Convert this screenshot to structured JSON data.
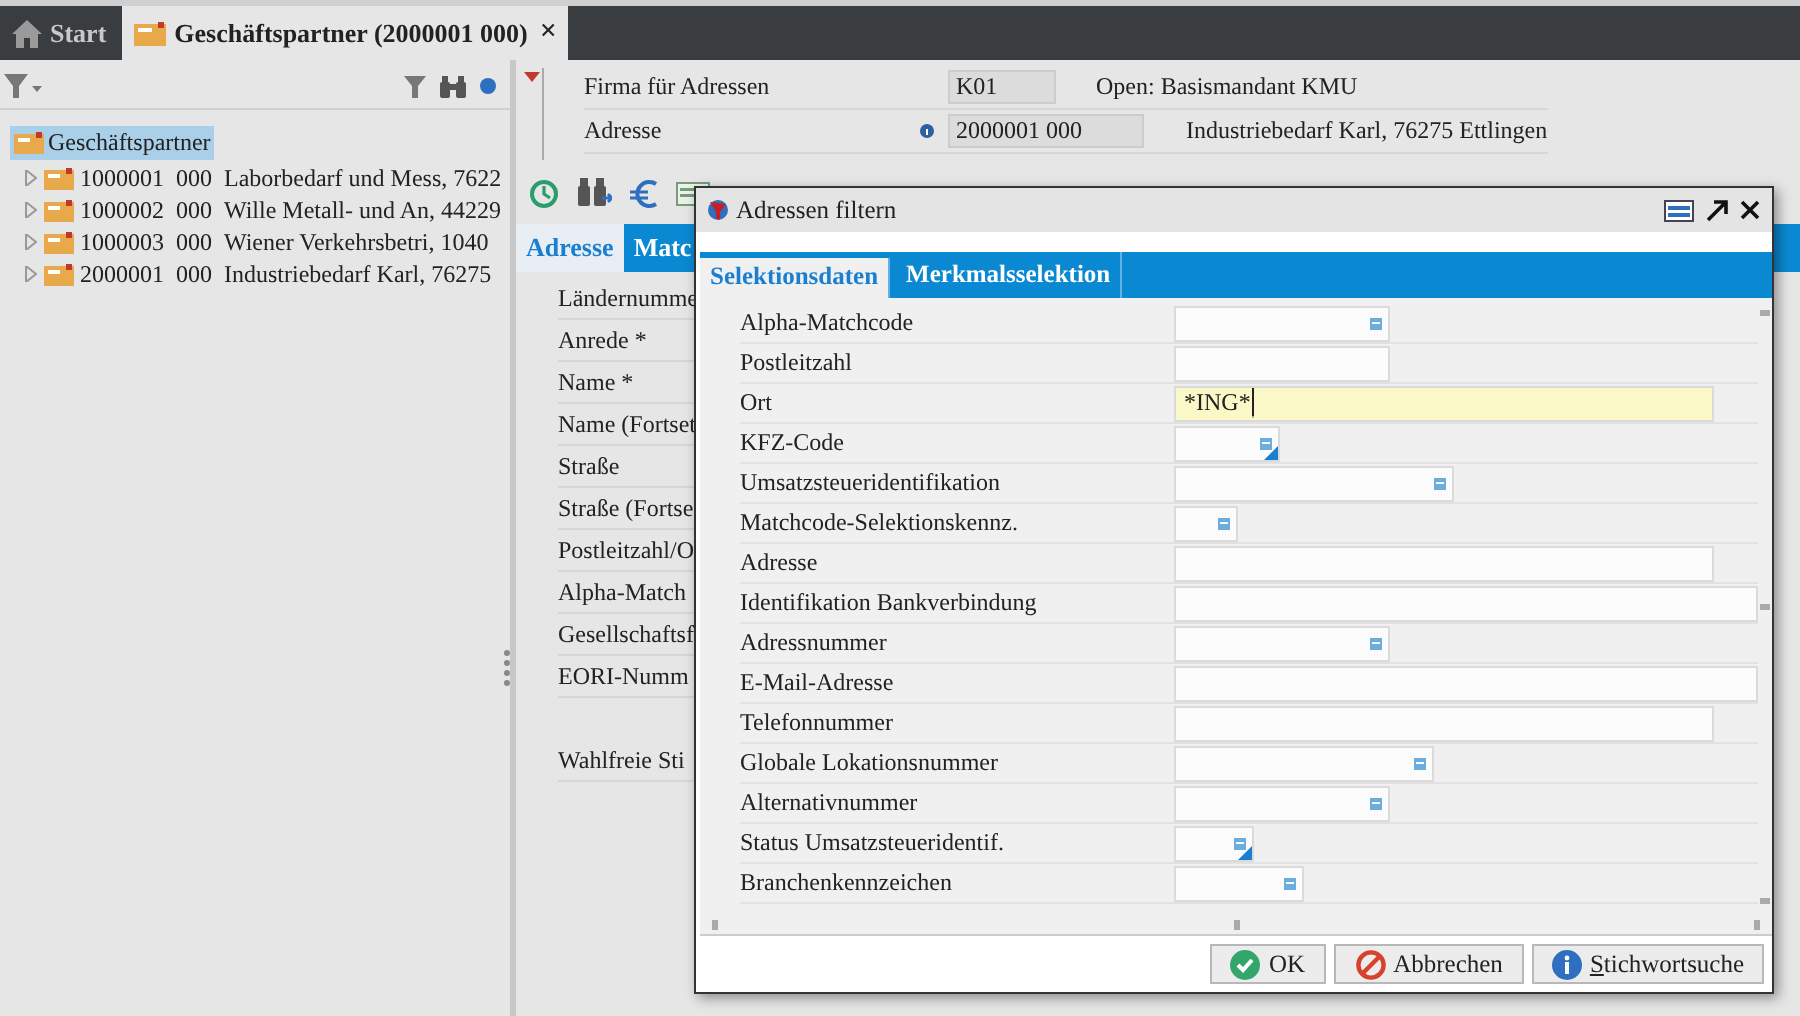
{
  "tabs": [
    {
      "label": "Start",
      "selected": false,
      "kind": "home"
    },
    {
      "label": "Geschäftspartner (2000001 000)",
      "selected": true,
      "kind": "folder",
      "close": "×"
    }
  ],
  "tree": {
    "label": "Geschäftspartner",
    "selected": true,
    "children": [
      {
        "number": "1000001",
        "sub": "000",
        "name": "Laborbedarf und Mess, 7622",
        "expanded": false
      },
      {
        "number": "1000002",
        "sub": "000",
        "name": "Wille Metall- und An, 44229",
        "expanded": false
      },
      {
        "number": "1000003",
        "sub": "000",
        "name": "Wiener Verkehrsbetri, 1040",
        "expanded": false
      },
      {
        "number": "2000001",
        "sub": "000",
        "name": "Industriebedarf Karl, 76275",
        "expanded": false
      }
    ]
  },
  "header_fields": [
    {
      "label": "Firma für Adressen",
      "value": "K01",
      "description": "Open: Basismandant KMU",
      "info": false
    },
    {
      "label": "Adresse",
      "value": "2000001 000",
      "description": "Industriebedarf Karl, 76275 Ettlingen",
      "info": true
    }
  ],
  "form_tabs": [
    {
      "label": "Adresse",
      "selected": true
    },
    {
      "label": "Matc",
      "selected": false
    }
  ],
  "form_labels": [
    "Ländernumme",
    "Anrede *",
    "Name *",
    "Name (Fortset",
    "Straße",
    "Straße (Fortse",
    "Postleitzahl/O",
    "Alpha-Match",
    "Gesellschaftsf",
    "EORI-Numm",
    "Wahlfreie Sti"
  ],
  "dialog": {
    "title": "Adressen filtern",
    "tabs": [
      {
        "label": "Selektionsdaten",
        "selected": true
      },
      {
        "label": "Merkmalsselektion",
        "selected": false
      }
    ],
    "fields": [
      {
        "label": "Alpha-Matchcode",
        "lookup": true,
        "dropdown": false,
        "focused": false
      },
      {
        "label": "Postleitzahl",
        "lookup": false,
        "dropdown": false,
        "focused": false
      },
      {
        "label": "Ort",
        "value": "*ING*",
        "lookup": false,
        "dropdown": false,
        "focused": true
      },
      {
        "label": "KFZ-Code",
        "lookup": true,
        "dropdown": true,
        "focused": false
      },
      {
        "label": "Umsatzsteueridentifikation",
        "lookup": true,
        "dropdown": false,
        "focused": false
      },
      {
        "label": "Matchcode-Selektionskennz.",
        "lookup": true,
        "dropdown": false,
        "focused": false
      },
      {
        "label": "Adresse",
        "lookup": false,
        "dropdown": false,
        "focused": false
      },
      {
        "label": "Identifikation Bankverbindung",
        "lookup": false,
        "dropdown": false,
        "focused": false
      },
      {
        "label": "Adressnummer",
        "lookup": true,
        "dropdown": false,
        "focused": false
      },
      {
        "label": "E-Mail-Adresse",
        "lookup": false,
        "dropdown": false,
        "focused": false
      },
      {
        "label": "Telefonnummer",
        "lookup": false,
        "dropdown": false,
        "focused": false
      },
      {
        "label": "Globale Lokationsnummer",
        "lookup": true,
        "dropdown": false,
        "focused": false
      },
      {
        "label": "Alternativnummer",
        "lookup": true,
        "dropdown": false,
        "focused": false
      },
      {
        "label": "Status Umsatzsteueridentif.",
        "lookup": true,
        "dropdown": true,
        "focused": false
      },
      {
        "label": "Branchenkennzeichen",
        "lookup": true,
        "dropdown": false,
        "focused": false
      }
    ],
    "buttons": [
      {
        "label": "OK",
        "kind": "ok"
      },
      {
        "label": "Abbrechen",
        "kind": "cancel"
      },
      {
        "label": "Stichwortsuche",
        "kind": "info"
      }
    ]
  }
}
